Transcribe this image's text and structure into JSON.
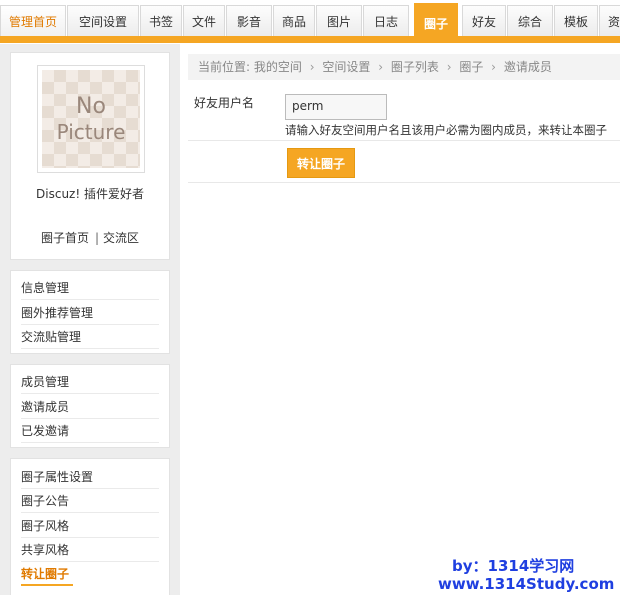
{
  "nav": {
    "tabs": [
      {
        "label": "管理首页"
      },
      {
        "label": "空间设置"
      },
      {
        "label": "书签"
      },
      {
        "label": "文件"
      },
      {
        "label": "影音"
      },
      {
        "label": "商品"
      },
      {
        "label": "图片"
      },
      {
        "label": "日志"
      },
      {
        "label": "圈子",
        "active": true
      },
      {
        "label": "好友"
      },
      {
        "label": "综合"
      },
      {
        "label": "模板"
      },
      {
        "label": "资"
      }
    ]
  },
  "profile": {
    "avatar_line1": "No",
    "avatar_line2": "Picture",
    "owner": "Discuz! 插件爱好者",
    "link_home": "圈子首页",
    "link_separator": "|",
    "link_forum": "交流区"
  },
  "sidebar": {
    "groups": [
      {
        "items": [
          "信息管理",
          "圈外推荐管理",
          "交流贴管理"
        ]
      },
      {
        "items": [
          "成员管理",
          "邀请成员",
          "已发邀请"
        ]
      },
      {
        "items": [
          "圈子属性设置",
          "圈子公告",
          "圈子风格",
          "共享风格",
          "转让圈子"
        ]
      }
    ],
    "current": "转让圈子"
  },
  "breadcrumb": {
    "prefix": "当前位置:",
    "items": [
      "我的空间",
      "空间设置",
      "圈子列表",
      "圈子",
      "邀请成员"
    ],
    "separator": "›"
  },
  "form": {
    "label": "好友用户名",
    "value": "perm",
    "hint": "请输入好友空间用户名且该用户必需为圈内成员，来转让本圈子",
    "submit_label": "转让圈子"
  },
  "watermark": {
    "line1": "by：1314学习网",
    "line2": "www.1314Study.com"
  },
  "colors": {
    "accent": "#f5a623",
    "watermark": "#1f3fe0"
  }
}
